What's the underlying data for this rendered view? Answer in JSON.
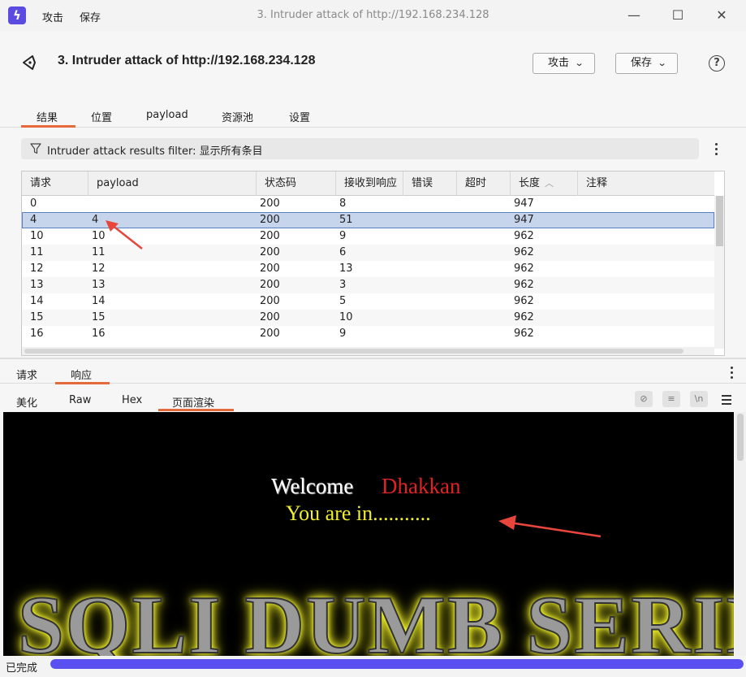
{
  "titlebar": {
    "menu": [
      "攻击",
      "保存"
    ],
    "window_title": "3. Intruder attack of http://192.168.234.128"
  },
  "header": {
    "title": "3. Intruder attack of http://192.168.234.128",
    "attack_button": "攻击",
    "save_button": "保存"
  },
  "tabs": [
    "结果",
    "位置",
    "payload",
    "资源池",
    "设置"
  ],
  "active_tab": "结果",
  "filter": {
    "text": "Intruder attack results filter: 显示所有条目"
  },
  "table": {
    "columns": [
      "请求",
      "payload",
      "状态码",
      "接收到响应",
      "错误",
      "超时",
      "长度",
      "注释"
    ],
    "sorted_column": "长度",
    "selected_request": "4",
    "rows": [
      [
        "0",
        "",
        "200",
        "8",
        "",
        "",
        "947",
        ""
      ],
      [
        "4",
        "4",
        "200",
        "51",
        "",
        "",
        "947",
        ""
      ],
      [
        "10",
        "10",
        "200",
        "9",
        "",
        "",
        "962",
        ""
      ],
      [
        "11",
        "11",
        "200",
        "6",
        "",
        "",
        "962",
        ""
      ],
      [
        "12",
        "12",
        "200",
        "13",
        "",
        "",
        "962",
        ""
      ],
      [
        "13",
        "13",
        "200",
        "3",
        "",
        "",
        "962",
        ""
      ],
      [
        "14",
        "14",
        "200",
        "5",
        "",
        "",
        "962",
        ""
      ],
      [
        "15",
        "15",
        "200",
        "10",
        "",
        "",
        "962",
        ""
      ],
      [
        "16",
        "16",
        "200",
        "9",
        "",
        "",
        "962",
        ""
      ]
    ]
  },
  "rr_tabs": [
    "请求",
    "响应"
  ],
  "active_rr_tab": "响应",
  "view_tabs": [
    "美化",
    "Raw",
    "Hex",
    "页面渲染"
  ],
  "active_view_tab": "页面渲染",
  "render": {
    "welcome": "Welcome",
    "username": "Dhakkan",
    "message": "You are in...........",
    "banner": "SQLI DUMB SERIES"
  },
  "status": {
    "text": "已完成",
    "progress": 1.0
  },
  "colors": {
    "accent": "#e46a3c",
    "selection": "#c7d5ec",
    "progress": "#5a4ff0",
    "annotation_arrow": "#e8463c"
  }
}
